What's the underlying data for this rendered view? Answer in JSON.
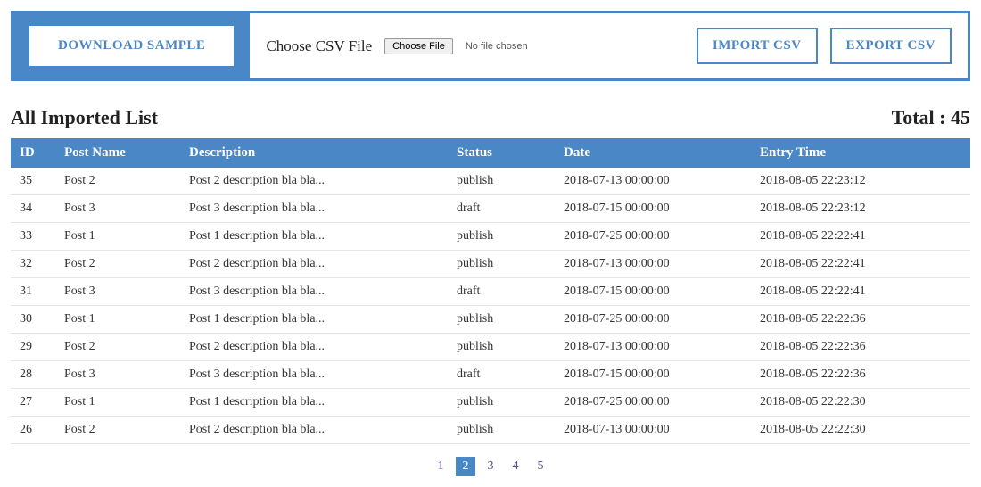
{
  "topbar": {
    "download_sample": "DOWNLOAD SAMPLE",
    "choose_csv_label": "Choose CSV File",
    "choose_file_btn": "Choose File",
    "no_file_text": "No file chosen",
    "import_csv": "IMPORT CSV",
    "export_csv": "EXPORT CSV"
  },
  "list_header": {
    "title": "All Imported List",
    "total_label": "Total :",
    "total_value": "45"
  },
  "table": {
    "headers": {
      "id": "ID",
      "post_name": "Post Name",
      "description": "Description",
      "status": "Status",
      "date": "Date",
      "entry_time": "Entry Time"
    },
    "rows": [
      {
        "id": "35",
        "name": "Post 2",
        "desc": "Post 2 description bla bla...",
        "status": "publish",
        "date": "2018-07-13 00:00:00",
        "entry": "2018-08-05 22:23:12"
      },
      {
        "id": "34",
        "name": "Post 3",
        "desc": "Post 3 description bla bla...",
        "status": "draft",
        "date": "2018-07-15 00:00:00",
        "entry": "2018-08-05 22:23:12"
      },
      {
        "id": "33",
        "name": "Post 1",
        "desc": "Post 1 description bla bla...",
        "status": "publish",
        "date": "2018-07-25 00:00:00",
        "entry": "2018-08-05 22:22:41"
      },
      {
        "id": "32",
        "name": "Post 2",
        "desc": "Post 2 description bla bla...",
        "status": "publish",
        "date": "2018-07-13 00:00:00",
        "entry": "2018-08-05 22:22:41"
      },
      {
        "id": "31",
        "name": "Post 3",
        "desc": "Post 3 description bla bla...",
        "status": "draft",
        "date": "2018-07-15 00:00:00",
        "entry": "2018-08-05 22:22:41"
      },
      {
        "id": "30",
        "name": "Post 1",
        "desc": "Post 1 description bla bla...",
        "status": "publish",
        "date": "2018-07-25 00:00:00",
        "entry": "2018-08-05 22:22:36"
      },
      {
        "id": "29",
        "name": "Post 2",
        "desc": "Post 2 description bla bla...",
        "status": "publish",
        "date": "2018-07-13 00:00:00",
        "entry": "2018-08-05 22:22:36"
      },
      {
        "id": "28",
        "name": "Post 3",
        "desc": "Post 3 description bla bla...",
        "status": "draft",
        "date": "2018-07-15 00:00:00",
        "entry": "2018-08-05 22:22:36"
      },
      {
        "id": "27",
        "name": "Post 1",
        "desc": "Post 1 description bla bla...",
        "status": "publish",
        "date": "2018-07-25 00:00:00",
        "entry": "2018-08-05 22:22:30"
      },
      {
        "id": "26",
        "name": "Post 2",
        "desc": "Post 2 description bla bla...",
        "status": "publish",
        "date": "2018-07-13 00:00:00",
        "entry": "2018-08-05 22:22:30"
      }
    ]
  },
  "pagination": {
    "pages": [
      "1",
      "2",
      "3",
      "4",
      "5"
    ],
    "active": "2"
  }
}
